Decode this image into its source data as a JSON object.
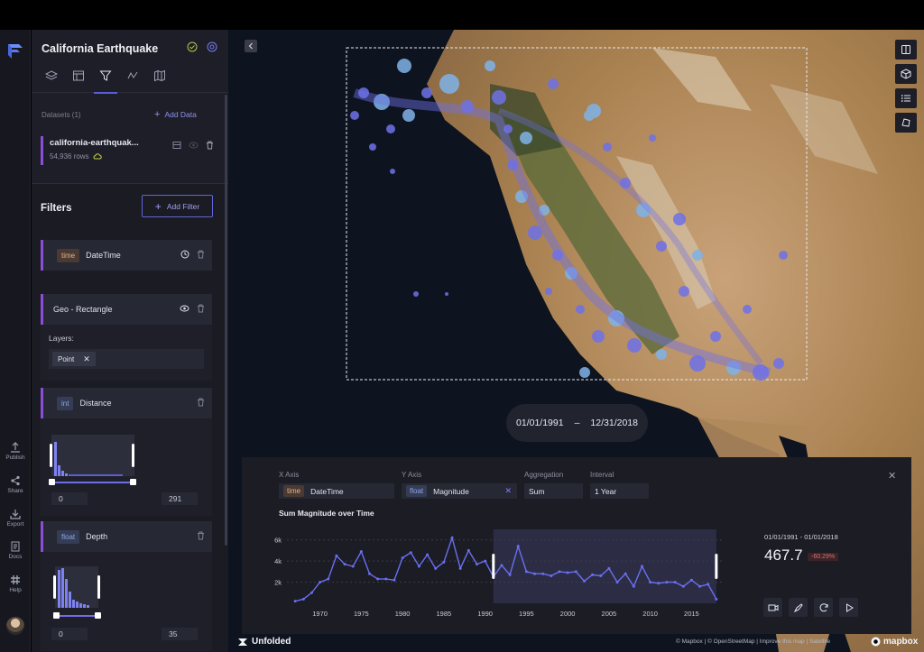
{
  "app": {
    "title": "California Earthquake"
  },
  "rail": {
    "items": [
      {
        "label": "Publish",
        "icon": "upload-icon"
      },
      {
        "label": "Share",
        "icon": "share-icon"
      },
      {
        "label": "Export",
        "icon": "download-icon"
      },
      {
        "label": "Docs",
        "icon": "docs-icon"
      },
      {
        "label": "Help",
        "icon": "slack-icon"
      }
    ]
  },
  "datasets": {
    "label": "Datasets (1)",
    "add_label": "Add Data",
    "item": {
      "name": "california-earthquak...",
      "rows": "54,936 rows"
    }
  },
  "filters": {
    "title": "Filters",
    "add_label": "Add Filter",
    "datetime": {
      "type": "time",
      "name": "DateTime"
    },
    "geo": {
      "name": "Geo - Rectangle",
      "layers_label": "Layers:",
      "layer_chip": "Point"
    },
    "distance": {
      "type": "int",
      "name": "Distance",
      "min": "0",
      "max": "291"
    },
    "depth": {
      "type": "float",
      "name": "Depth",
      "min": "0",
      "max": "35"
    }
  },
  "map": {
    "time_start": "01/01/1991",
    "time_sep": "–",
    "time_end": "12/31/2018",
    "attribution": "© Mapbox | © OpenStreetMap | Improve this map | Satellite",
    "unfolded": "Unfolded",
    "mapbox": "mapbox"
  },
  "chart_panel": {
    "x_axis_label": "X Axis",
    "x_type": "time",
    "x_field": "DateTime",
    "y_axis_label": "Y Axis",
    "y_type": "float",
    "y_field": "Magnitude",
    "aggregation_label": "Aggregation",
    "aggregation": "Sum",
    "interval_label": "Interval",
    "interval": "1 Year",
    "chart_title": "Sum Magnitude over Time",
    "range_text": "01/01/1991 - 01/01/2018",
    "big_value": "467.7",
    "delta": "-60.29%"
  },
  "chart_data": {
    "type": "line",
    "title": "Sum Magnitude over Time",
    "xlabel": "",
    "ylabel": "",
    "x": [
      1967,
      1968,
      1969,
      1970,
      1971,
      1972,
      1973,
      1974,
      1975,
      1976,
      1977,
      1978,
      1979,
      1980,
      1981,
      1982,
      1983,
      1984,
      1985,
      1986,
      1987,
      1988,
      1989,
      1990,
      1991,
      1992,
      1993,
      1994,
      1995,
      1996,
      1997,
      1998,
      1999,
      2000,
      2001,
      2002,
      2003,
      2004,
      2005,
      2006,
      2007,
      2008,
      2009,
      2010,
      2011,
      2012,
      2013,
      2014,
      2015,
      2016,
      2017,
      2018
    ],
    "values": [
      0.2,
      0.4,
      1.0,
      2.0,
      2.3,
      4.5,
      3.7,
      3.5,
      4.9,
      2.8,
      2.3,
      2.3,
      2.2,
      4.3,
      4.8,
      3.5,
      4.6,
      3.3,
      3.9,
      6.2,
      3.3,
      5.0,
      3.7,
      4.0,
      2.5,
      3.6,
      2.7,
      5.4,
      3.0,
      2.8,
      2.8,
      2.6,
      3.0,
      2.9,
      3.0,
      2.1,
      2.7,
      2.6,
      3.3,
      2.0,
      2.8,
      1.6,
      3.5,
      2.0,
      1.9,
      2.0,
      2.0,
      1.6,
      2.2,
      1.6,
      1.8,
      0.4
    ],
    "ytick_labels": [
      "2k",
      "4k",
      "6k"
    ],
    "yticks": [
      2,
      4,
      6
    ],
    "ylim": [
      0,
      7
    ],
    "xtick_labels": [
      "1970",
      "1975",
      "1980",
      "1985",
      "1990",
      "1995",
      "2000",
      "2005",
      "2010",
      "2015"
    ],
    "xticks": [
      1970,
      1975,
      1980,
      1985,
      1990,
      1995,
      2000,
      2005,
      2010,
      2015
    ],
    "xlim": [
      1966,
      2019
    ],
    "selection": [
      1991,
      2018
    ],
    "colors": {
      "line": "#6a6ff0",
      "selection": "#2c2d45"
    }
  }
}
